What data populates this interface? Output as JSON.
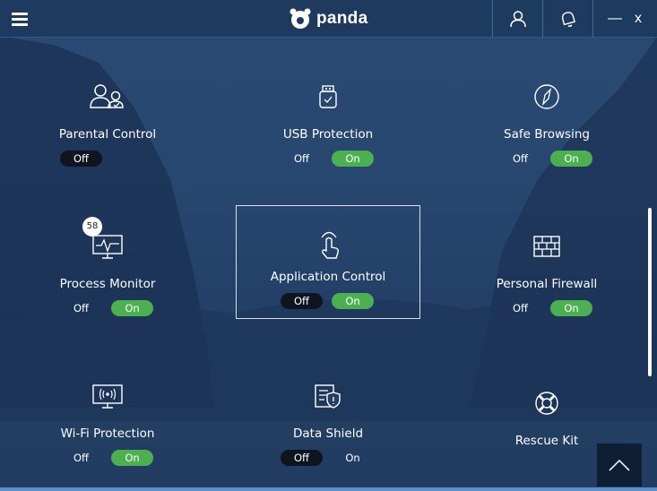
{
  "app": {
    "brand": "panda"
  },
  "titlebar": {
    "menu_icon": "hamburger-menu-icon",
    "user_icon": "user-icon",
    "notification_icon": "bell-icon",
    "minimize_label": "—",
    "close_label": "x"
  },
  "features": [
    {
      "key": "parental",
      "label": "Parental Control",
      "icon": "parents-icon",
      "toggle": {
        "off": "Off",
        "on": null,
        "state": "off"
      }
    },
    {
      "key": "usb",
      "label": "USB Protection",
      "icon": "usb-icon",
      "toggle": {
        "off": "Off",
        "on": "On",
        "state": "on"
      }
    },
    {
      "key": "safe-browsing",
      "label": "Safe Browsing",
      "icon": "compass-icon",
      "toggle": {
        "off": "Off",
        "on": "On",
        "state": "on"
      }
    },
    {
      "key": "process-monitor",
      "label": "Process Monitor",
      "icon": "monitor-pulse-icon",
      "badge": "58",
      "toggle": {
        "off": "Off",
        "on": "On",
        "state": "on"
      }
    },
    {
      "key": "application-control",
      "label": "Application Control",
      "icon": "touch-hand-icon",
      "selected": true,
      "toggle": {
        "off": "Off",
        "on": "On",
        "state": "both"
      }
    },
    {
      "key": "personal-firewall",
      "label": "Personal Firewall",
      "icon": "firewall-icon",
      "toggle": {
        "off": "Off",
        "on": "On",
        "state": "on"
      }
    },
    {
      "key": "wifi-protection",
      "label": "Wi-Fi Protection",
      "icon": "wifi-monitor-icon",
      "toggle": {
        "off": "Off",
        "on": "On",
        "state": "on"
      }
    },
    {
      "key": "data-shield",
      "label": "Data Shield",
      "icon": "document-shield-icon",
      "toggle": {
        "off": "Off",
        "on": "On",
        "state": "off"
      }
    },
    {
      "key": "rescue-kit",
      "label": "Rescue Kit",
      "icon": "lifebuoy-icon"
    }
  ],
  "colors": {
    "accent_on": "#4caf50",
    "off_active": "#0e1520",
    "titlebar": "#1e3a5e"
  },
  "scroll_to_top_icon": "chevron-up-icon"
}
